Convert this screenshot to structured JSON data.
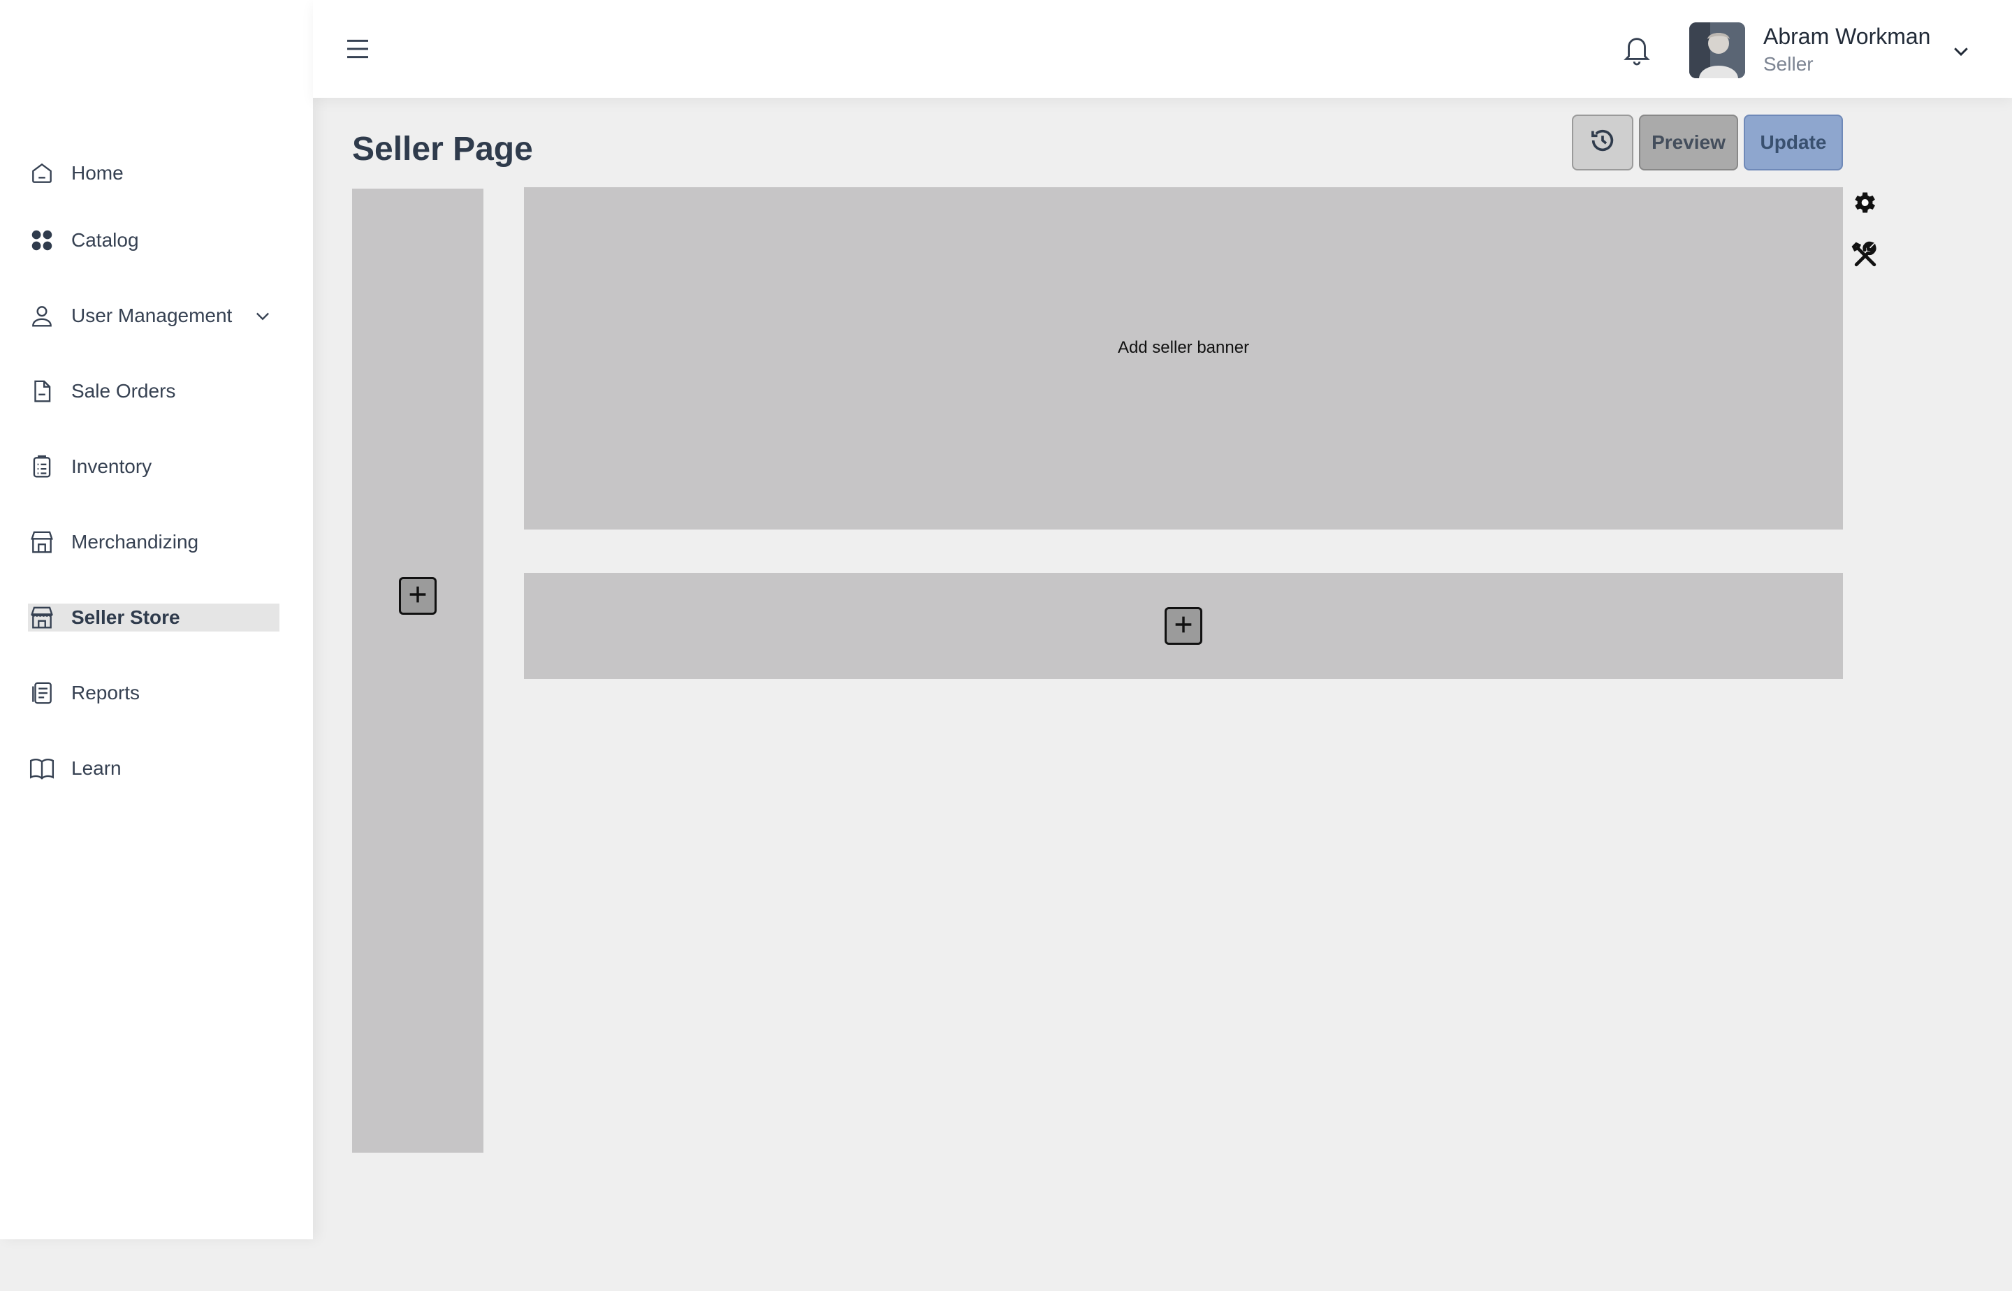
{
  "sidebar": {
    "items": [
      {
        "label": "Home",
        "icon": "home-icon"
      },
      {
        "label": "Catalog",
        "icon": "grid-icon"
      },
      {
        "label": "User Management",
        "icon": "user-icon"
      },
      {
        "label": "Sale Orders",
        "icon": "document-icon"
      },
      {
        "label": "Inventory",
        "icon": "clipboard-list-icon"
      },
      {
        "label": "Merchandizing",
        "icon": "storefront-icon"
      },
      {
        "label": "Seller Store",
        "icon": "store-icon",
        "active": true
      },
      {
        "label": "Reports",
        "icon": "report-icon"
      },
      {
        "label": "Learn",
        "icon": "book-icon"
      }
    ]
  },
  "header": {
    "user_name": "Abram Workman",
    "user_role": "Seller"
  },
  "page": {
    "title": "Seller Page",
    "preview_label": "Preview",
    "update_label": "Update"
  },
  "editor": {
    "banner_text": "Add seller banner"
  },
  "colors": {
    "accent": "#8ea6ce",
    "placeholder_block": "#c6c5c6",
    "background": "#efefef"
  }
}
